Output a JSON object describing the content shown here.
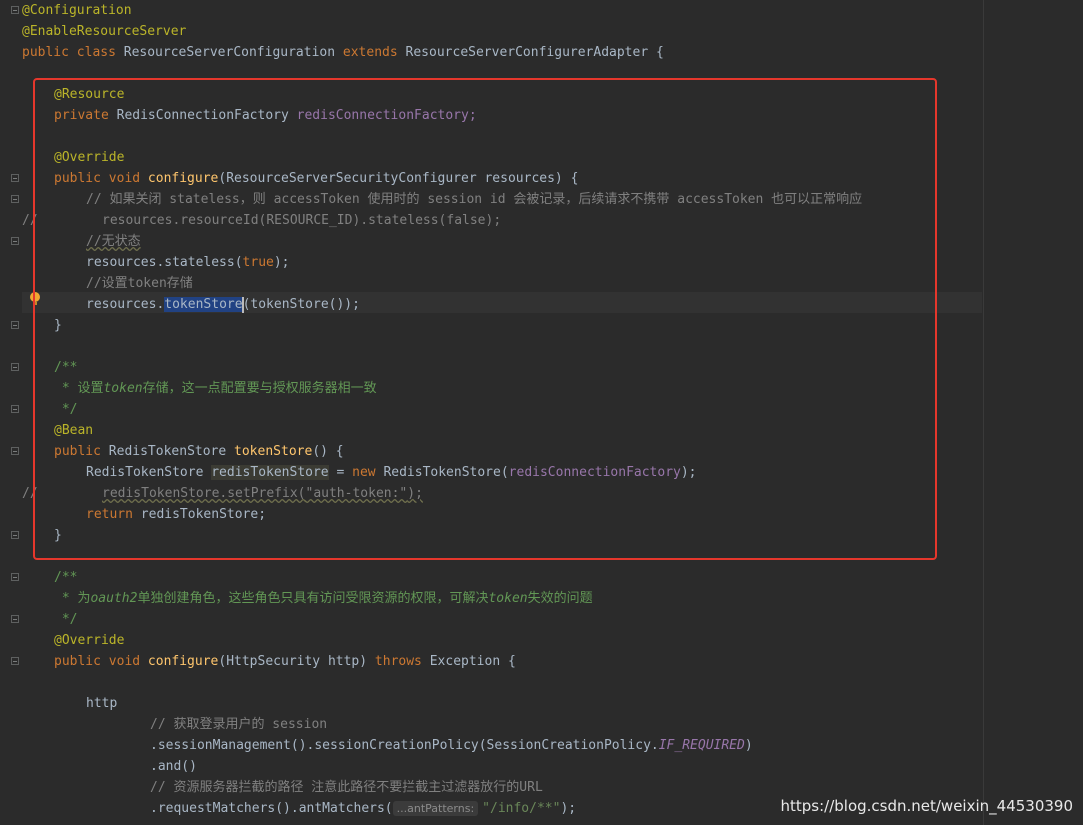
{
  "editor": {
    "lines": {
      "l0": "@Configuration",
      "l1": "@EnableResourceServer",
      "l2_public": "public class ",
      "l2_name": "ResourceServerConfiguration ",
      "l2_extends": "extends ",
      "l2_parent": "ResourceServerConfigurerAdapter {",
      "l4": "@Resource",
      "l5_kw": "private ",
      "l5_type": "RedisConnectionFactory ",
      "l5_field": "redisConnectionFactory;",
      "l7": "@Override",
      "l8_kw": "public void ",
      "l8_fn": "configure",
      "l8_rest": "(ResourceServerSecurityConfigurer resources) {",
      "l9": "// 如果关闭 stateless，则 accessToken 使用时的 session id 会被记录，后续请求不携带 accessToken 也可以正常响应",
      "l10_mark": "//",
      "l10": "resources.resourceId(RESOURCE_ID).stateless(false);",
      "l11": "//无状态",
      "l12_a": "resources.stateless(",
      "l12_kw": "true",
      "l12_b": ");",
      "l13": "//设置token存储",
      "l14_a": "resources.",
      "l14_sel": "tokenStore",
      "l14_b": "(tokenStore());",
      "l15": "}",
      "l17": "/**",
      "l18_a": " * 设置",
      "l18_it": "token",
      "l18_b": "存储，这一点配置要与授权服务器相一致",
      "l19": " */",
      "l20": "@Bean",
      "l21_kw": "public ",
      "l21_type": "RedisTokenStore ",
      "l21_fn": "tokenStore",
      "l21_rest": "() {",
      "l22_type": "RedisTokenStore ",
      "l22_var": "redisTokenStore",
      "l22_eq": " = ",
      "l22_new": "new ",
      "l22_ctor": "RedisTokenStore(",
      "l22_arg": "redisConnectionFactory",
      "l22_end": ");",
      "l23_mark": "//",
      "l23_a": "redisTokenStore.setPrefix(",
      "l23_str": "\"auth-token:\"",
      "l23_b": ");",
      "l24_kw": "return ",
      "l24_rest": "redisTokenStore;",
      "l25": "}",
      "l27": "/**",
      "l28_a": " * 为",
      "l28_it1": "oauth2",
      "l28_b": "单独创建角色，这些角色只具有访问受限资源的权限，可解决",
      "l28_it2": "token",
      "l28_c": "失效的问题",
      "l29": " */",
      "l30": "@Override",
      "l31_kw": "public void ",
      "l31_fn": "configure",
      "l31_a": "(HttpSecurity http) ",
      "l31_kw2": "throws ",
      "l31_b": "Exception {",
      "l33": "http",
      "l34": "// 获取登录用户的 session",
      "l35_a": ".sessionManagement().sessionCreationPolicy(SessionCreationPolicy.",
      "l35_st": "IF_REQUIRED",
      "l35_b": ")",
      "l36": ".and()",
      "l37": "// 资源服务器拦截的路径 注意此路径不要拦截主过滤器放行的URL",
      "l38_a": ".requestMatchers().antMatchers(",
      "l38_hint": "...antPatterns:",
      "l38_str": "\"/info/**\"",
      "l38_b": ");"
    }
  },
  "watermark": "https://blog.csdn.net/weixin_44530390",
  "colors": {
    "background": "#2b2b2b",
    "keyword": "#cc7832",
    "annotation": "#bbb529",
    "method": "#ffc66d",
    "field": "#9876aa",
    "comment": "#808080",
    "doc": "#629755",
    "highlight_box": "#e5372c"
  }
}
